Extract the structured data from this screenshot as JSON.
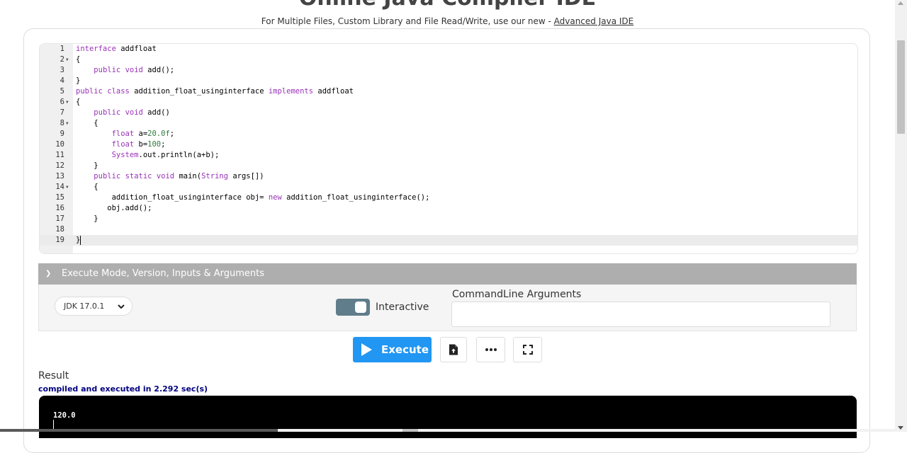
{
  "header": {
    "title": "Online Java Compiler IDE",
    "subtitle_prefix": "For Multiple Files, Custom Library and File Read/Write, use our new - ",
    "subtitle_link": "Advanced Java IDE"
  },
  "editor": {
    "lines": [
      {
        "n": "1",
        "fold": false,
        "active": false,
        "tokens": [
          {
            "t": "interface",
            "k": true
          },
          {
            "t": " addfloat"
          }
        ]
      },
      {
        "n": "2",
        "fold": true,
        "active": false,
        "tokens": [
          {
            "t": "{"
          }
        ]
      },
      {
        "n": "3",
        "fold": false,
        "active": false,
        "tokens": [
          {
            "t": "    "
          },
          {
            "t": "public",
            "k": true
          },
          {
            "t": " "
          },
          {
            "t": "void",
            "k": true
          },
          {
            "t": " add();"
          }
        ]
      },
      {
        "n": "4",
        "fold": false,
        "active": false,
        "tokens": [
          {
            "t": "}"
          }
        ]
      },
      {
        "n": "5",
        "fold": false,
        "active": false,
        "tokens": [
          {
            "t": "public",
            "k": true
          },
          {
            "t": " "
          },
          {
            "t": "class",
            "k": true
          },
          {
            "t": " addition_float_usinginterface "
          },
          {
            "t": "implements",
            "k": true
          },
          {
            "t": " addfloat"
          }
        ]
      },
      {
        "n": "6",
        "fold": true,
        "active": false,
        "tokens": [
          {
            "t": "{"
          }
        ]
      },
      {
        "n": "7",
        "fold": false,
        "active": false,
        "tokens": [
          {
            "t": "    "
          },
          {
            "t": "public",
            "k": true
          },
          {
            "t": " "
          },
          {
            "t": "void",
            "k": true
          },
          {
            "t": " add()"
          }
        ]
      },
      {
        "n": "8",
        "fold": true,
        "active": false,
        "tokens": [
          {
            "t": "    {"
          }
        ]
      },
      {
        "n": "9",
        "fold": false,
        "active": false,
        "tokens": [
          {
            "t": "        "
          },
          {
            "t": "float",
            "k": true
          },
          {
            "t": " a="
          },
          {
            "t": "20.0f",
            "num": true
          },
          {
            "t": ";"
          }
        ]
      },
      {
        "n": "10",
        "fold": false,
        "active": false,
        "tokens": [
          {
            "t": "        "
          },
          {
            "t": "float",
            "k": true
          },
          {
            "t": " b="
          },
          {
            "t": "100",
            "num": true
          },
          {
            "t": ";"
          }
        ]
      },
      {
        "n": "11",
        "fold": false,
        "active": false,
        "tokens": [
          {
            "t": "        "
          },
          {
            "t": "System",
            "k": true
          },
          {
            "t": ".out.println(a+b);"
          }
        ]
      },
      {
        "n": "12",
        "fold": false,
        "active": false,
        "tokens": [
          {
            "t": "    }"
          }
        ]
      },
      {
        "n": "13",
        "fold": false,
        "active": false,
        "tokens": [
          {
            "t": "    "
          },
          {
            "t": "public",
            "k": true
          },
          {
            "t": " "
          },
          {
            "t": "static",
            "k": true
          },
          {
            "t": " "
          },
          {
            "t": "void",
            "k": true
          },
          {
            "t": " main("
          },
          {
            "t": "String",
            "k": true
          },
          {
            "t": " args[])"
          }
        ]
      },
      {
        "n": "14",
        "fold": true,
        "active": false,
        "tokens": [
          {
            "t": "    {"
          }
        ]
      },
      {
        "n": "15",
        "fold": false,
        "active": false,
        "tokens": [
          {
            "t": "        addition_float_usinginterface obj= "
          },
          {
            "t": "new",
            "k": true
          },
          {
            "t": " addition_float_usinginterface();"
          }
        ]
      },
      {
        "n": "16",
        "fold": false,
        "active": false,
        "tokens": [
          {
            "t": "       obj.add();"
          }
        ]
      },
      {
        "n": "17",
        "fold": false,
        "active": false,
        "tokens": [
          {
            "t": "    }"
          }
        ]
      },
      {
        "n": "18",
        "fold": false,
        "active": false,
        "tokens": [
          {
            "t": ""
          }
        ]
      },
      {
        "n": "19",
        "fold": false,
        "active": true,
        "tokens": [
          {
            "t": "}"
          }
        ]
      }
    ]
  },
  "execute_panel": {
    "header_label": "Execute Mode, Version, Inputs & Arguments",
    "jdk_version": "JDK 17.0.1",
    "interactive_label": "Interactive",
    "interactive_on": true,
    "cmd_args_label": "CommandLine Arguments",
    "cmd_args_value": ""
  },
  "toolbar": {
    "execute_label": "Execute",
    "accent_color": "#2196f3",
    "icons": [
      "file-upload-icon",
      "more-dots-icon",
      "fullscreen-icon"
    ]
  },
  "result": {
    "label": "Result",
    "status": "compiled and executed in 2.292 sec(s)",
    "output": "120.0"
  }
}
